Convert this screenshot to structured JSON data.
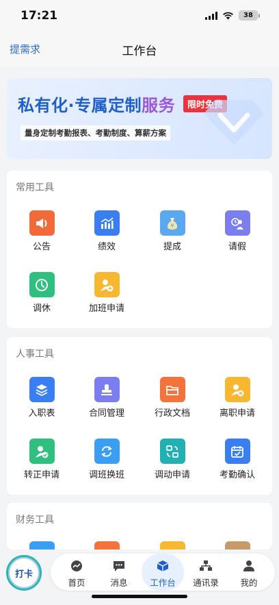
{
  "status_bar": {
    "time": "17:21",
    "battery": "38"
  },
  "nav": {
    "left_link": "提需求",
    "title": "工作台"
  },
  "banner": {
    "title_part1": "私有化·专属定制",
    "title_part2": "服务",
    "badge": "限时免费",
    "subtitle": "量身定制考勤报表、考勤制度、算薪方案"
  },
  "sections": [
    {
      "title": "常用工具",
      "items": [
        {
          "label": "公告",
          "icon": "megaphone-icon",
          "color": "#f26a3a"
        },
        {
          "label": "绩效",
          "icon": "bar-chart-icon",
          "color": "#3a7ff2"
        },
        {
          "label": "提成",
          "icon": "money-bag-icon",
          "color": "#5aa8ef"
        },
        {
          "label": "请假",
          "icon": "person-clock-icon",
          "color": "#7c7df0"
        },
        {
          "label": "调休",
          "icon": "clock-icon",
          "color": "#2fbf7f"
        },
        {
          "label": "加班申请",
          "icon": "person-add-icon",
          "color": "#f7b731"
        }
      ]
    },
    {
      "title": "人事工具",
      "items": [
        {
          "label": "入职表",
          "icon": "stack-icon",
          "color": "#3a7ff2"
        },
        {
          "label": "合同管理",
          "icon": "stamp-icon",
          "color": "#7c7df0"
        },
        {
          "label": "行政文档",
          "icon": "folder-icon",
          "color": "#f2743a"
        },
        {
          "label": "离职申请",
          "icon": "person-remove-icon",
          "color": "#f7b731"
        },
        {
          "label": "转正申请",
          "icon": "person-check-icon",
          "color": "#2fbf7f"
        },
        {
          "label": "调班换班",
          "icon": "refresh-icon",
          "color": "#3a9ff2"
        },
        {
          "label": "调动申请",
          "icon": "transfer-icon",
          "color": "#22b0b5"
        },
        {
          "label": "考勤确认",
          "icon": "calendar-check-icon",
          "color": "#3a7ff2"
        }
      ]
    },
    {
      "title": "财务工具",
      "items": [
        {
          "label": "",
          "icon": "card-icon",
          "color": "#3a9ff2"
        },
        {
          "label": "",
          "icon": "finance-icon-2",
          "color": "#f2743a"
        },
        {
          "label": "",
          "icon": "finance-icon-3",
          "color": "#f7b731"
        },
        {
          "label": "",
          "icon": "finance-icon-4",
          "color": "#c79a6a"
        }
      ]
    }
  ],
  "tab_bar": {
    "punch_label": "打卡",
    "tabs": [
      {
        "label": "首页",
        "icon": "home-chart-icon"
      },
      {
        "label": "消息",
        "icon": "message-icon"
      },
      {
        "label": "工作台",
        "icon": "workbench-icon"
      },
      {
        "label": "通讯录",
        "icon": "contacts-icon"
      },
      {
        "label": "我的",
        "icon": "profile-icon"
      }
    ],
    "active_tab": "工作台"
  }
}
